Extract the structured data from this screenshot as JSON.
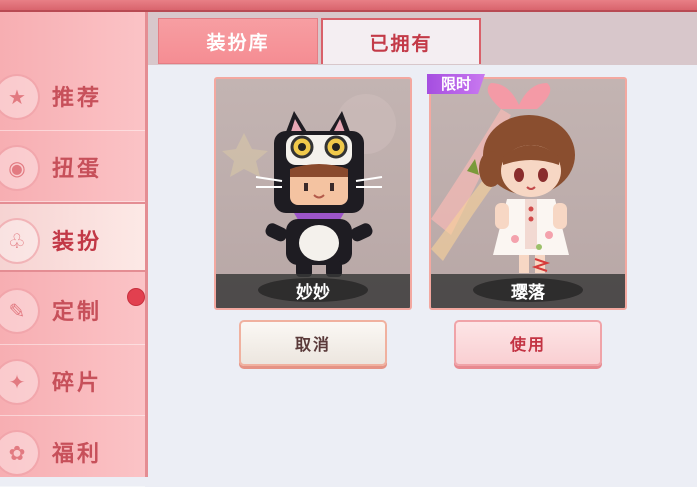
{
  "tabs": [
    {
      "label": "装扮库"
    },
    {
      "label": "已拥有"
    }
  ],
  "sidebar": {
    "items": [
      {
        "label": "推荐",
        "icon": "star-icon"
      },
      {
        "label": "扭蛋",
        "icon": "capsule-icon"
      },
      {
        "label": "装扮",
        "icon": "shirt-icon",
        "active": true
      },
      {
        "label": "定制",
        "icon": "pencil-icon",
        "notification": true
      },
      {
        "label": "碎片",
        "icon": "puzzle-icon"
      },
      {
        "label": "福利",
        "icon": "gift-icon"
      }
    ]
  },
  "outfits": [
    {
      "name": "妙妙",
      "button": "取消"
    },
    {
      "name": "璎落",
      "badge": "限时",
      "button": "使用"
    }
  ],
  "colors": {
    "sidebar_bg": "#f7aeb2",
    "accent_red": "#c33a48",
    "limited_purple": "#a54ee0",
    "content_bg": "#eceef5"
  }
}
